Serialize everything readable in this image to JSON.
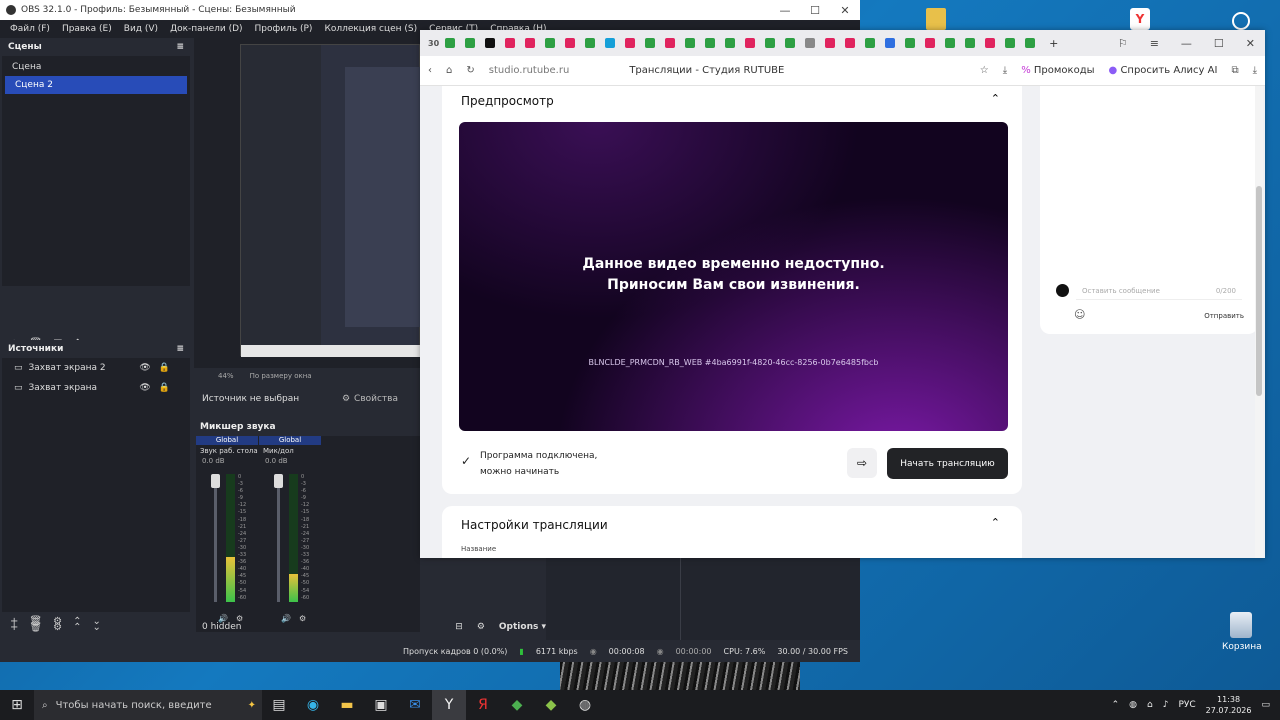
{
  "obs": {
    "title": "OBS 32.1.0 - Профиль: Безымянный - Сцены: Безымянный",
    "menu": [
      "Файл (F)",
      "Правка (E)",
      "Вид (V)",
      "Док-панели (D)",
      "Профиль (P)",
      "Коллекция сцен (S)",
      "Сервис (T)",
      "Справка (H)"
    ],
    "scenes_title": "Сцены",
    "scenes": [
      "Сцена",
      "Сцена 2"
    ],
    "sources_title": "Источники",
    "sources": [
      "Захват экрана 2",
      "Захват экрана"
    ],
    "no_source": "Источник не выбран",
    "properties": "Свойства",
    "mixer_title": "Микшер звука",
    "mixer_channels": [
      {
        "tag": "Global",
        "name": "Звук раб. стола",
        "db": "0.0 dB",
        "level": 0.35
      },
      {
        "tag": "Global",
        "name": "Мик/дол",
        "db": "0.0 dB",
        "level": 0.22
      }
    ],
    "meter_ticks": [
      "0",
      "-3",
      "-6",
      "-9",
      "-12",
      "-15",
      "-18",
      "-21",
      "-24",
      "-27",
      "-30",
      "-33",
      "-36",
      "-40",
      "-45",
      "-50",
      "-54",
      "-60"
    ],
    "zoom": "44%",
    "fit": "По размеру окна",
    "hidden": "0 hidden",
    "options": "Options",
    "status": {
      "dropped": "Пропуск кадров 0 (0.0%)",
      "bitrate": "6171 kbps",
      "rec_time": "00:00:08",
      "stream_time": "00:00:00",
      "cpu": "CPU: 7.6%",
      "fps": "30.00 / 30.00 FPS"
    }
  },
  "browser": {
    "url": "studio.rutube.ru",
    "page_title": "Трансляции - Студия RUTUBE",
    "promo": "Промокоды",
    "alice": "Спросить Алису AI",
    "preview_title": "Предпросмотр",
    "video_msg_1": "Данное видео временно недоступно.",
    "video_msg_2": "Приносим Вам свои извинения.",
    "video_code": "BLNCLDE_PRMCDN_RB_WEB #4ba6991f-4820-46cc-8256-0b7e6485fbcb",
    "status_1": "Программа подключена,",
    "status_2": "можно начинать",
    "start_button": "Начать трансляцию",
    "settings_title": "Настройки трансляции",
    "name_label": "Название",
    "chat_placeholder": "Оставить сообщение",
    "chat_count": "0/200",
    "chat_send": "Отправить"
  },
  "desktop": {
    "recycle_bin": "Корзина"
  },
  "taskbar": {
    "search_placeholder": "Чтобы начать поиск, введите",
    "lang": "РУС",
    "time": "11:38",
    "date": "27.07.2026"
  }
}
